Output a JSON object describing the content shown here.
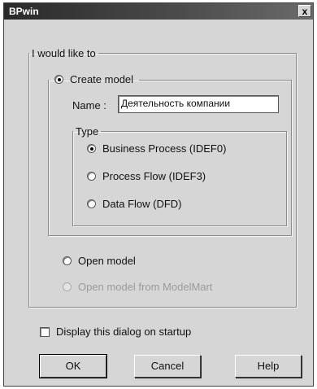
{
  "window": {
    "title": "BPwin",
    "close_glyph": "x"
  },
  "group_main": {
    "legend": "I would like to"
  },
  "create_model": {
    "label": "Create model",
    "selected": true,
    "name_label": "Name :",
    "name_value": "Деятельность компании"
  },
  "type_group": {
    "legend": "Type",
    "options": [
      {
        "label": "Business Process (IDEF0)",
        "selected": true
      },
      {
        "label": "Process Flow (IDEF3)",
        "selected": false
      },
      {
        "label": "Data Flow (DFD)",
        "selected": false
      }
    ]
  },
  "open_model": {
    "label": "Open model",
    "selected": false
  },
  "open_modelmart": {
    "label": "Open model from ModelMart",
    "enabled": false
  },
  "startup_checkbox": {
    "label": "Display this dialog on startup",
    "checked": false
  },
  "buttons": {
    "ok": "OK",
    "cancel": "Cancel",
    "help": "Help"
  }
}
